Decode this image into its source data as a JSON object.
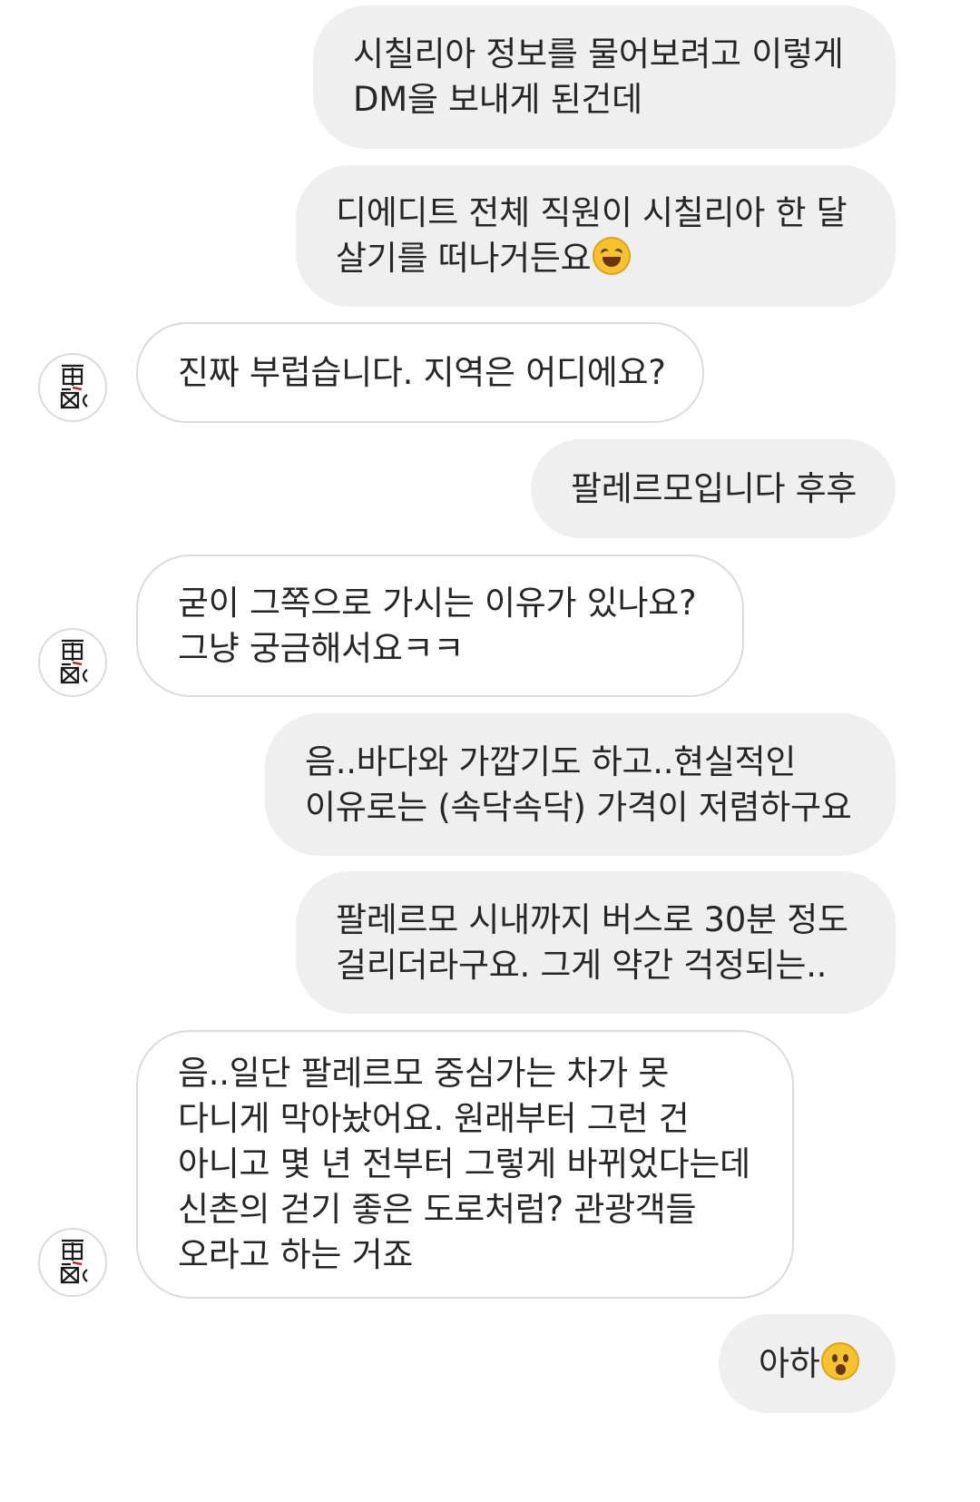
{
  "conversation": {
    "messages": [
      {
        "sender": "me",
        "lines": [
          "시칠리아 정보를 물어보려고 이렇게",
          "DM을 보내게 된건데"
        ]
      },
      {
        "sender": "me",
        "lines": [
          "디에디트 전체 직원이 시칠리아 한 달",
          "살기를 떠나거든요"
        ],
        "trailing_emoji": "grinning-squinting-face-emoji"
      },
      {
        "sender": "other",
        "lines": [
          "진짜 부럽습니다. 지역은 어디에요?"
        ]
      },
      {
        "sender": "me",
        "lines": [
          "팔레르모입니다 후후"
        ]
      },
      {
        "sender": "other",
        "lines": [
          "굳이 그쪽으로 가시는 이유가 있나요?",
          "그냥 궁금해서요ㅋㅋ"
        ]
      },
      {
        "sender": "me",
        "lines": [
          "음..바다와 가깝기도 하고..현실적인",
          "이유로는 (속닥속닥) 가격이 저렴하구요"
        ]
      },
      {
        "sender": "me",
        "lines": [
          "팔레르모 시내까지 버스로 30분 정도",
          "걸리더라구요. 그게 약간 걱정되는.."
        ]
      },
      {
        "sender": "other",
        "lines": [
          "음..일단 팔레르모 중심가는 차가 못",
          "다니게 막아놨어요. 원래부터 그런 건",
          "아니고 몇 년 전부터 그렇게 바뀌었다는데",
          "신촌의 걷기 좋은 도로처럼? 관광객들",
          "오라고 하는 거죠"
        ]
      },
      {
        "sender": "me",
        "lines": [
          "아하"
        ],
        "trailing_emoji": "hushed-face-emoji"
      }
    ]
  },
  "colors": {
    "outgoing_bubble": "#efefef",
    "incoming_bubble": "#ffffff",
    "incoming_border": "#dbdbdb",
    "text": "#262626",
    "emoji_yellow": "#f7c22f"
  },
  "icons": {
    "avatar": "contact-avatar-icon"
  }
}
